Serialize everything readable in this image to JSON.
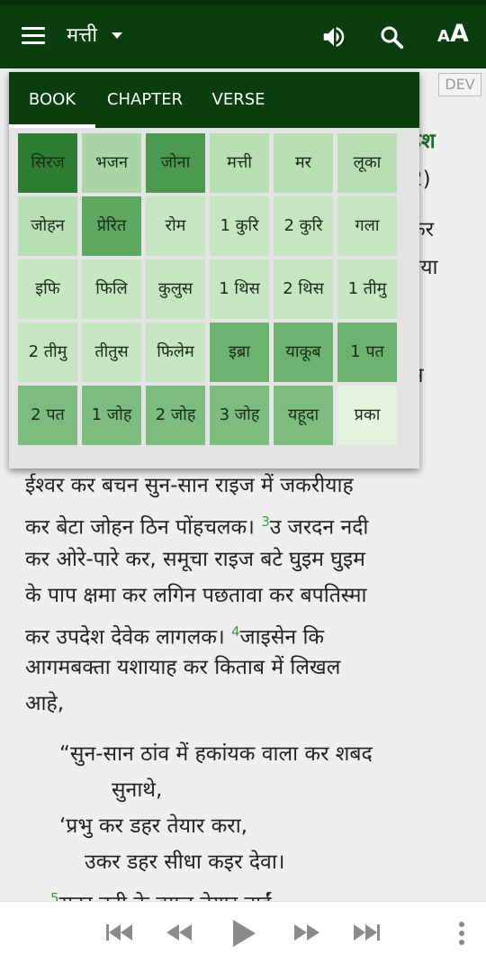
{
  "appbar": {
    "book_title": "मत्ती",
    "icons": [
      "menu-icon",
      "chevron-down-icon",
      "speaker-icon",
      "search-icon",
      "font-size-icon"
    ],
    "font_small": "A",
    "font_big": "A"
  },
  "badge": {
    "label": "DEV"
  },
  "popup": {
    "tabs": [
      {
        "label": "BOOK"
      },
      {
        "label": "CHAPTER"
      },
      {
        "label": "VERSE"
      }
    ],
    "books": [
      {
        "label": "सिरज",
        "color": "#2e7d32"
      },
      {
        "label": "भजन",
        "color": "#a8d5a4"
      },
      {
        "label": "जोना",
        "color": "#4c9a50"
      },
      {
        "label": "मत्ती",
        "color": "#b8deb4"
      },
      {
        "label": "मर",
        "color": "#b8deb4"
      },
      {
        "label": "लूका",
        "color": "#b8deb4"
      },
      {
        "label": "जोहन",
        "color": "#b8deb4"
      },
      {
        "label": "प्रेरित",
        "color": "#5fa862"
      },
      {
        "label": "रोम",
        "color": "#c6e6c2"
      },
      {
        "label": "1 कुरि",
        "color": "#c6e6c2"
      },
      {
        "label": "2 कुरि",
        "color": "#c6e6c2"
      },
      {
        "label": "गला",
        "color": "#c6e6c2"
      },
      {
        "label": "इफि",
        "color": "#c6e6c2"
      },
      {
        "label": "फिलि",
        "color": "#c6e6c2"
      },
      {
        "label": "कुलुस",
        "color": "#c6e6c2"
      },
      {
        "label": "1 थिस",
        "color": "#c6e6c2"
      },
      {
        "label": "2 थिस",
        "color": "#c6e6c2"
      },
      {
        "label": "1 तीमु",
        "color": "#c6e6c2"
      },
      {
        "label": "2 तीमु",
        "color": "#c6e6c2"
      },
      {
        "label": "तीतुस",
        "color": "#c6e6c2"
      },
      {
        "label": "फिलेम",
        "color": "#c6e6c2"
      },
      {
        "label": "इब्रा",
        "color": "#6db370"
      },
      {
        "label": "याकूब",
        "color": "#6db370"
      },
      {
        "label": "1 पत",
        "color": "#6db370"
      },
      {
        "label": "2 पत",
        "color": "#7dbc7f"
      },
      {
        "label": "1 जोह",
        "color": "#7dbc7f"
      },
      {
        "label": "2 जोह",
        "color": "#7dbc7f"
      },
      {
        "label": "3 जोह",
        "color": "#7dbc7f"
      },
      {
        "label": "यहूदा",
        "color": "#7dbc7f"
      },
      {
        "label": "प्रका",
        "color": "#e3f3e0"
      }
    ]
  },
  "peek": [
    {
      "text": "ढ़श"
    },
    {
      "text": "2)"
    },
    {
      "text": "कर"
    },
    {
      "text": "दया"
    },
    {
      "text": "र"
    },
    {
      "text": "स"
    },
    {
      "text": "र"
    }
  ],
  "scripture": {
    "line1": "ईश्वर कर बचन सुन-सान राइज में जकरीयाह",
    "line2a": "कर बेटा जोहन ठिन पोंहचलक। ",
    "v3": "3",
    "line2b": "उ जरदन नदी",
    "line3": "कर ओरे-पारे कर, समूचा राइज बटे घुइम घुइम",
    "line4": "के पाप क्षमा कर लगिन पछतावा कर बपतिस्मा",
    "line5a": "कर उपदेश देवेक लागलक। ",
    "v4": "4",
    "line5b": "जाइसेन कि",
    "line6": "आगमबक्ता यशायाह कर किताब में लिखल",
    "line7": "आहे,",
    "poem1": "“सुन-सान ठांव में हकांयक वाला कर शबद",
    "poem2": "सुनाथे,",
    "poem3": "‘प्रभु कर डहर तेयार करा,",
    "poem4": "उकर डहर सीधा कइर देवा।",
    "v5": "5",
    "partial": "सदर नदी के बगल तेयार नाईं"
  },
  "player": {
    "icons": [
      "skip-previous-icon",
      "rewind-icon",
      "play-icon",
      "fast-forward-icon",
      "skip-next-icon",
      "more-vert-icon"
    ],
    "colors": {
      "controls": "#8a8a8a"
    }
  },
  "colors": {
    "appbar": "#0a3e0e",
    "verse_number": "#3a9a3f",
    "text": "#222222"
  }
}
